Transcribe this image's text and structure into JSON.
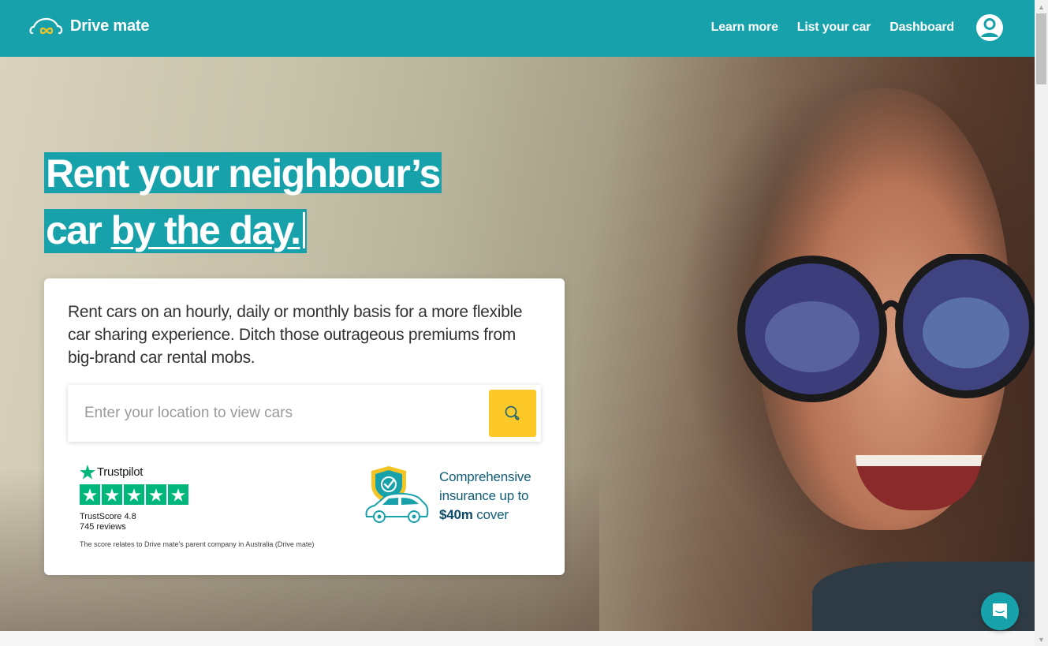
{
  "header": {
    "brand": "Drive mate",
    "nav": [
      {
        "label": "Learn more"
      },
      {
        "label": "List your car"
      },
      {
        "label": "Dashboard"
      }
    ],
    "account_icon": "user-circle-icon"
  },
  "hero": {
    "title_line1": "Rent your neighbour’s",
    "title_line2_plain": "car ",
    "title_line2_underlined": "by the day.",
    "description": "Rent cars on an hourly, daily or monthly basis for a more flexible car sharing experience. Ditch those outrageous premiums from big-brand car rental mobs.",
    "search": {
      "value": "",
      "placeholder": "Enter your location to view cars",
      "button_icon": "search-icon"
    }
  },
  "trustpilot": {
    "brand": "Trustpilot",
    "stars": 5,
    "score_label": "TrustScore 4.8",
    "reviews_label": "745 reviews",
    "note": "The score relates to Drive mate's parent company in Australia (Drive mate)"
  },
  "insurance": {
    "line1": "Comprehensive",
    "line2": "insurance up to",
    "amount": "$40m",
    "line3_suffix": " cover"
  },
  "colors": {
    "brand_teal": "#17a2ab",
    "accent_yellow": "#fdc928",
    "trustpilot_green": "#00b67a",
    "insurance_text": "#0f5e78"
  }
}
